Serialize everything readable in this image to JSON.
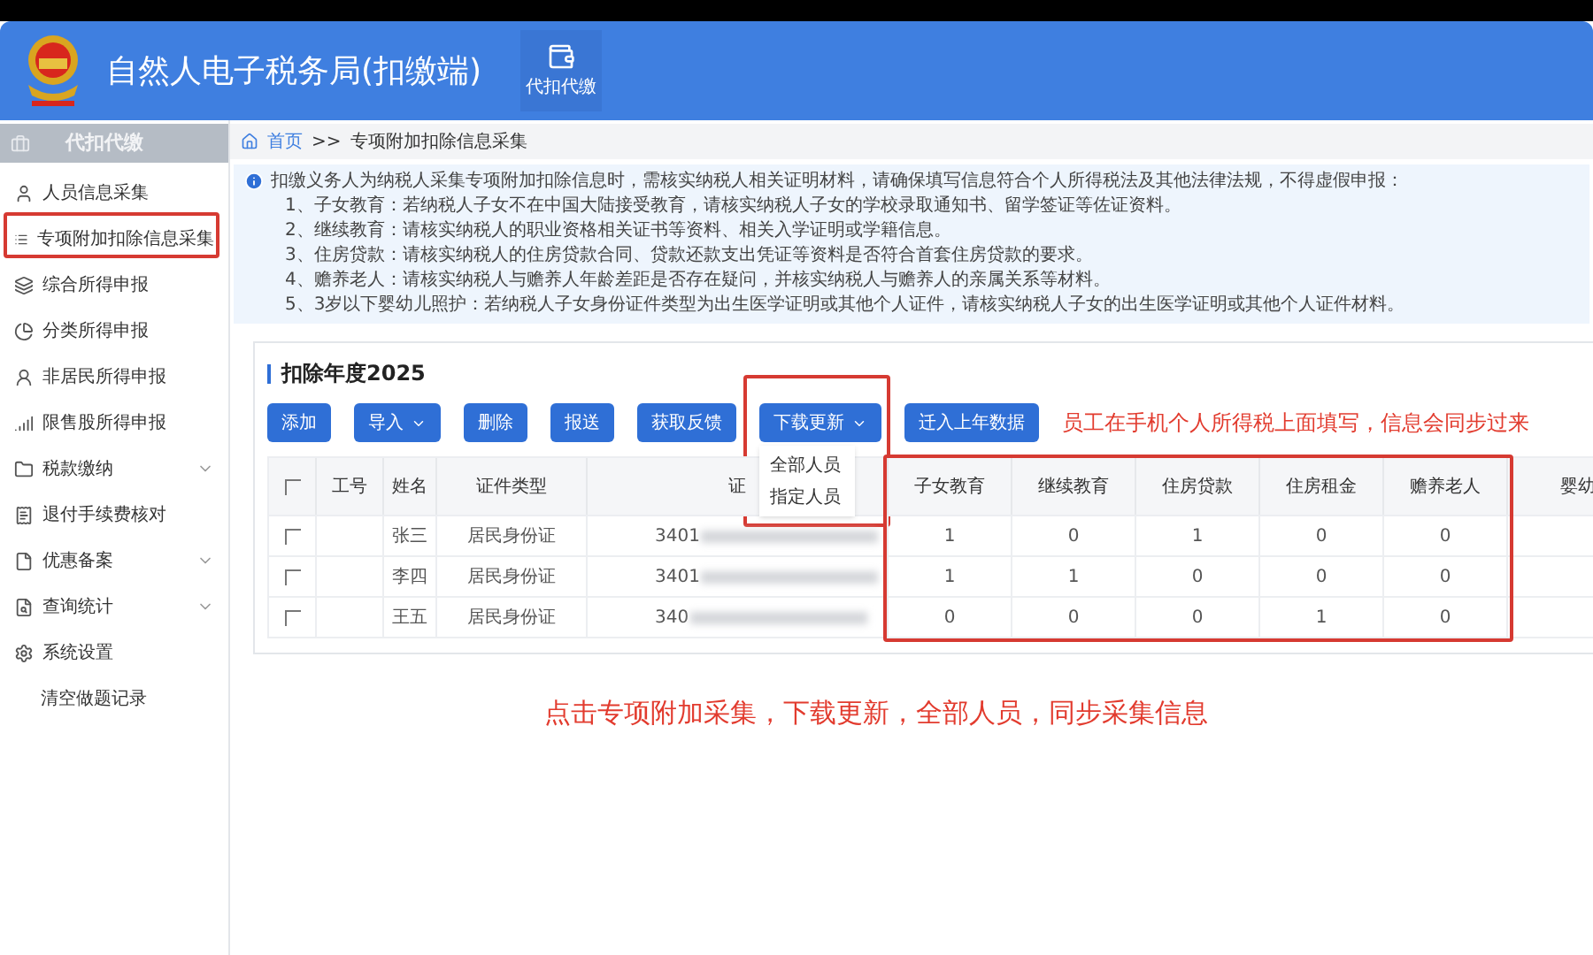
{
  "header": {
    "title": "自然人电子税务局(扣缴端)",
    "module_label": "代扣代缴"
  },
  "sidebar": {
    "section_title": "代扣代缴",
    "items": [
      {
        "label": "人员信息采集",
        "has_submenu": false
      },
      {
        "label": "专项附加扣除信息采集",
        "has_submenu": false
      },
      {
        "label": "综合所得申报",
        "has_submenu": false
      },
      {
        "label": "分类所得申报",
        "has_submenu": false
      },
      {
        "label": "非居民所得申报",
        "has_submenu": false
      },
      {
        "label": "限售股所得申报",
        "has_submenu": false
      },
      {
        "label": "税款缴纳",
        "has_submenu": true
      },
      {
        "label": "退付手续费核对",
        "has_submenu": false
      },
      {
        "label": "优惠备案",
        "has_submenu": true
      },
      {
        "label": "查询统计",
        "has_submenu": true
      },
      {
        "label": "系统设置",
        "has_submenu": false
      },
      {
        "label": "清空做题记录",
        "has_submenu": false
      }
    ]
  },
  "breadcrumb": {
    "home": "首页",
    "separator": ">>",
    "current": "专项附加扣除信息采集"
  },
  "notice": {
    "lines": [
      "扣缴义务人为纳税人采集专项附加扣除信息时，需核实纳税人相关证明材料，请确保填写信息符合个人所得税法及其他法律法规，不得虚假申报：",
      "1、子女教育：若纳税人子女不在中国大陆接受教育，请核实纳税人子女的学校录取通知书、留学签证等佐证资料。",
      "2、继续教育：请核实纳税人的职业资格相关证书等资料、相关入学证明或学籍信息。",
      "3、住房贷款：请核实纳税人的住房贷款合同、贷款还款支出凭证等资料是否符合首套住房贷款的要求。",
      "4、赡养老人：请核实纳税人与赡养人年龄差距是否存在疑问，并核实纳税人与赡养人的亲属关系等材料。",
      "5、3岁以下婴幼儿照护：若纳税人子女身份证件类型为出生医学证明或其他个人证件，请核实纳税人子女的出生医学证明或其他个人证件材料。"
    ]
  },
  "card": {
    "title": "扣除年度2025",
    "buttons": [
      {
        "label": "添加",
        "has_dropdown": false
      },
      {
        "label": "导入",
        "has_dropdown": true
      },
      {
        "label": "删除",
        "has_dropdown": false
      },
      {
        "label": "报送",
        "has_dropdown": false
      },
      {
        "label": "获取反馈",
        "has_dropdown": false
      },
      {
        "label": "下载更新",
        "has_dropdown": true,
        "menu_open": true
      },
      {
        "label": "迁入上年数据",
        "has_dropdown": false
      }
    ],
    "dropdown_menu": [
      "全部人员",
      "指定人员"
    ]
  },
  "table": {
    "header_checked": false,
    "columns": [
      "工号",
      "姓名",
      "证件类型",
      "证",
      "子女教育",
      "继续教育",
      "住房贷款",
      "住房租金",
      "赡养老人",
      "婴幼"
    ],
    "rows": [
      {
        "checked": false,
        "name": "张三",
        "id_type": "居民身份证",
        "id_number": "3401",
        "values": [
          "1",
          "0",
          "1",
          "0",
          "0"
        ]
      },
      {
        "checked": false,
        "name": "李四",
        "id_type": "居民身份证",
        "id_number": "3401",
        "values": [
          "1",
          "1",
          "0",
          "0",
          "0"
        ]
      },
      {
        "checked": false,
        "name": "王五",
        "id_type": "居民身份证",
        "id_number": "340",
        "values": [
          "0",
          "0",
          "0",
          "1",
          "0"
        ]
      }
    ]
  },
  "annotations": {
    "top_note": "员工在手机个人所得税上面填写，信息会同步过来",
    "bottom_note": "点击专项附加采集，下载更新，全部人员，同步采集信息"
  }
}
